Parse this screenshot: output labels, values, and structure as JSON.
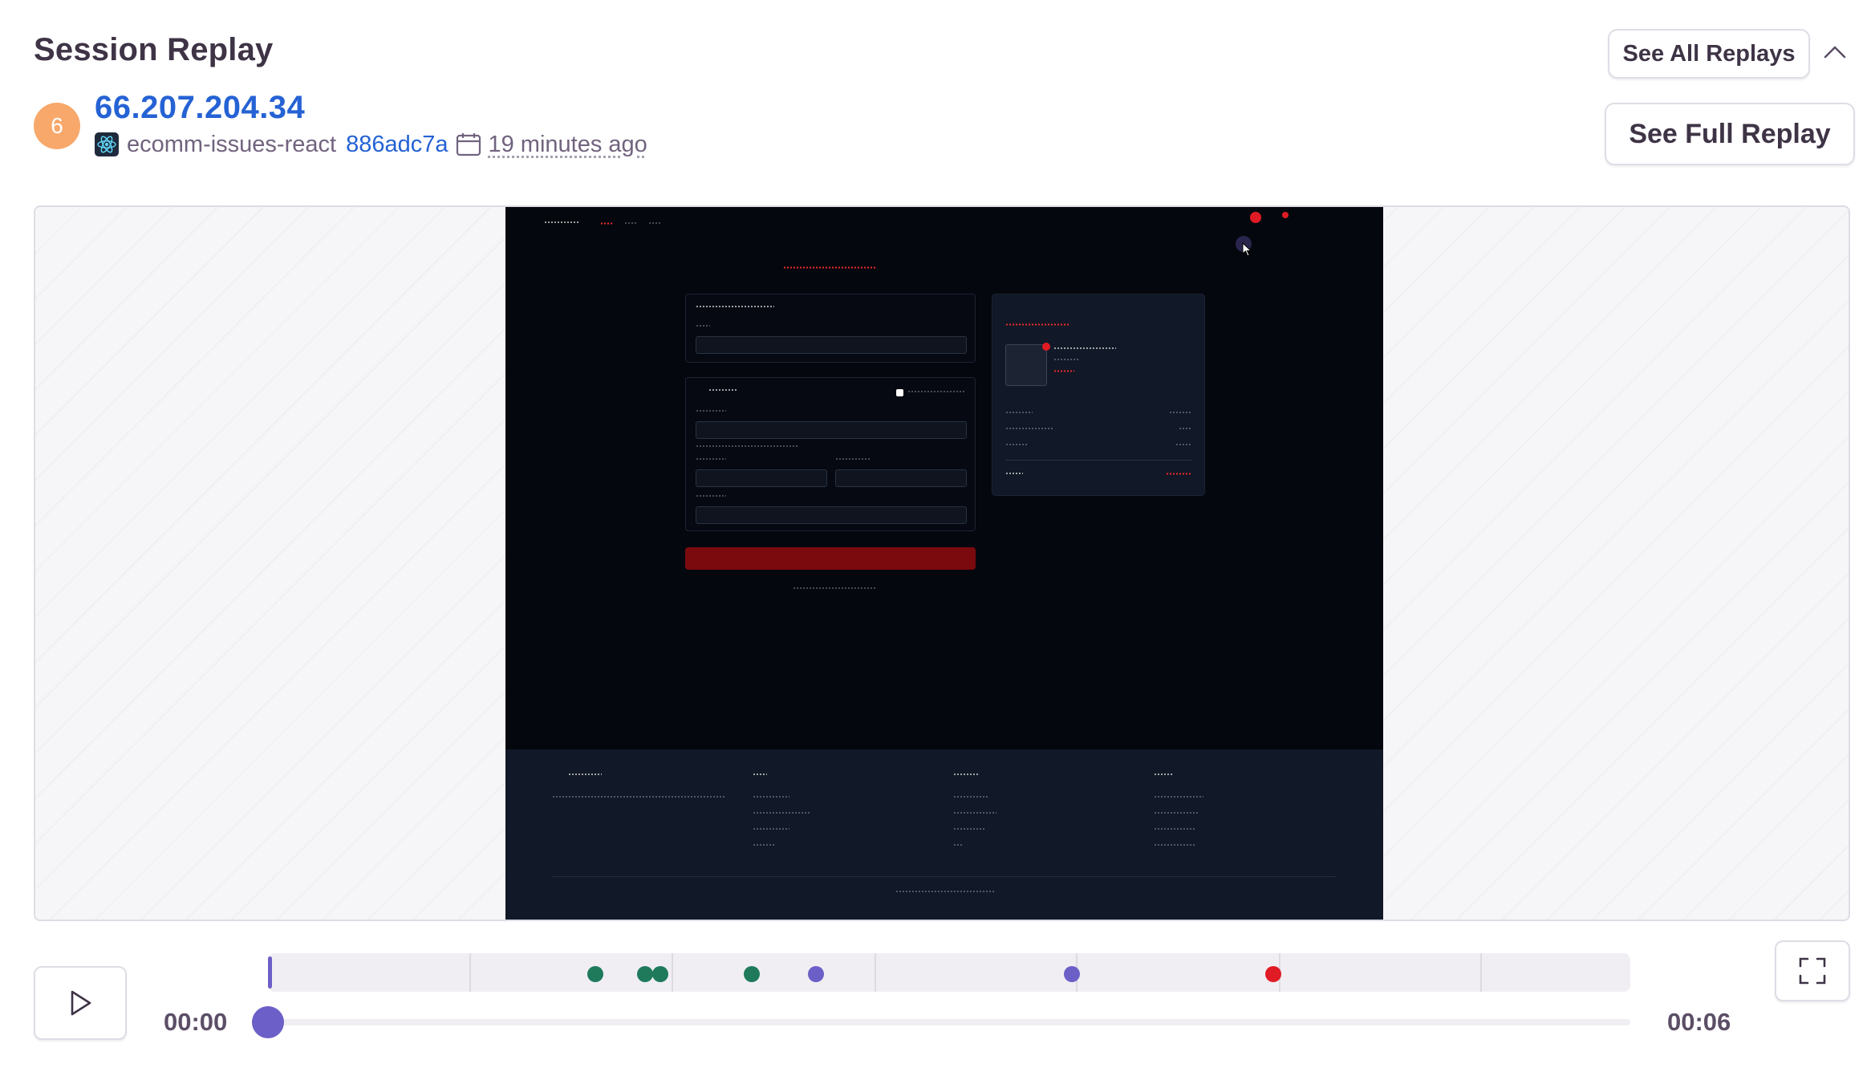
{
  "header": {
    "title": "Session Replay",
    "see_all_label": "See All Replays",
    "see_full_label": "See Full Replay"
  },
  "session": {
    "avatar_initial": "6",
    "avatar_color": "#f8a86a",
    "ip": "66.207.204.34",
    "project": "ecomm-issues-react",
    "release": "886adc7a",
    "time_ago": "19 minutes ago"
  },
  "player": {
    "current_time": "00:00",
    "duration": "00:06",
    "progress": 0,
    "accent_color": "#6c5fc7",
    "events": [
      {
        "type": "navigation",
        "color": "#1f7a5c",
        "position": 0.24
      },
      {
        "type": "navigation",
        "color": "#1f7a5c",
        "position": 0.277
      },
      {
        "type": "navigation",
        "color": "#1f7a5c",
        "position": 0.288
      },
      {
        "type": "navigation",
        "color": "#1f7a5c",
        "position": 0.355
      },
      {
        "type": "click",
        "color": "#6c5fc7",
        "position": 0.402
      },
      {
        "type": "click",
        "color": "#6c5fc7",
        "position": 0.59
      },
      {
        "type": "error",
        "color": "#e01b24",
        "position": 0.738
      }
    ],
    "ticks": [
      0.148,
      0.296,
      0.445,
      0.593,
      0.742,
      0.89
    ]
  },
  "icons": {
    "platform": "react-icon",
    "calendar": "calendar-icon",
    "collapse": "chevron-up-icon",
    "play": "play-icon",
    "fullscreen": "fullscreen-icon"
  }
}
